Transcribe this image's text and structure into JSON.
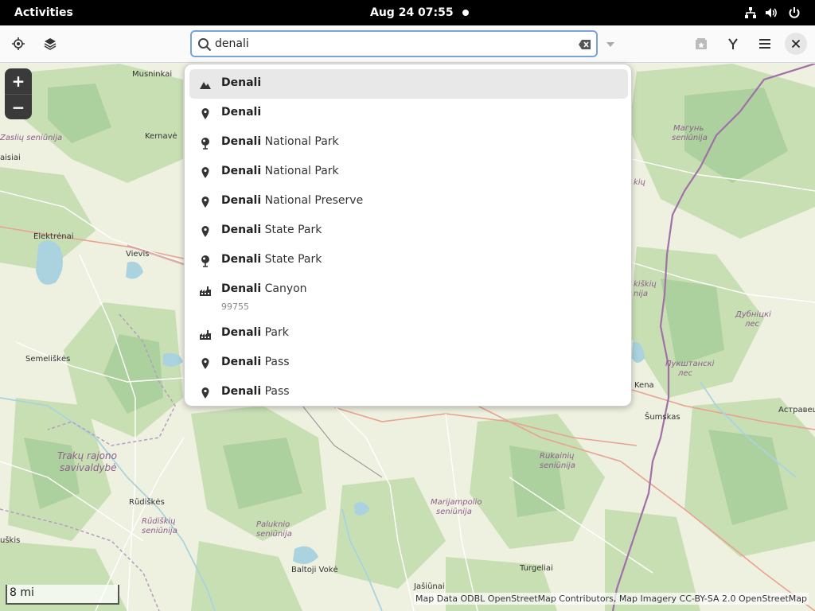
{
  "topbar": {
    "activities": "Activities",
    "clock": "Aug 24  07:55",
    "icons": [
      "network-icon",
      "volume-icon",
      "power-icon"
    ]
  },
  "header": {
    "buttons_left": [
      "locate-icon",
      "layers-icon"
    ],
    "search": {
      "value": "denali",
      "placeholder": ""
    },
    "buttons_right": [
      "favorites-icon",
      "route-icon",
      "menu-icon",
      "close-icon"
    ]
  },
  "results": [
    {
      "icon": "mountain-icon",
      "bold": "Denali",
      "rest": "",
      "sub": ""
    },
    {
      "icon": "pin-icon",
      "bold": "Denali",
      "rest": "",
      "sub": ""
    },
    {
      "icon": "tree-icon",
      "bold": "Denali",
      "rest": " National Park",
      "sub": ""
    },
    {
      "icon": "pin-icon",
      "bold": "Denali",
      "rest": " National Park",
      "sub": ""
    },
    {
      "icon": "pin-icon",
      "bold": "Denali",
      "rest": " National Preserve",
      "sub": ""
    },
    {
      "icon": "pin-icon",
      "bold": "Denali",
      "rest": " State Park",
      "sub": ""
    },
    {
      "icon": "tree-icon",
      "bold": "Denali",
      "rest": " State Park",
      "sub": ""
    },
    {
      "icon": "town-icon",
      "bold": "Denali",
      "rest": " Canyon",
      "sub": "99755"
    },
    {
      "icon": "town-icon",
      "bold": "Denali",
      "rest": " Park",
      "sub": ""
    },
    {
      "icon": "pin-icon",
      "bold": "Denali",
      "rest": " Pass",
      "sub": ""
    },
    {
      "icon": "pin-icon",
      "bold": "Denali",
      "rest": " Pass",
      "sub": ""
    }
  ],
  "map": {
    "zoom_in": "+",
    "zoom_out": "−",
    "scale": "8 mi",
    "attribution": "Map Data ODBL OpenStreetMap Contributors, Map Imagery CC-BY-SA 2.0 OpenStreetMap",
    "places": [
      {
        "name": "Musninkai"
      },
      {
        "name": "Kernavė"
      },
      {
        "name": "Zaslių seniūnija"
      },
      {
        "name": "aisiai"
      },
      {
        "name": "Elektrėnai"
      },
      {
        "name": "Vievis"
      },
      {
        "name": "Semeliškės"
      },
      {
        "name": "Trakų rajono"
      },
      {
        "name": "savivaldybė"
      },
      {
        "name": "Rūdiškės"
      },
      {
        "name": "Rūdiškių"
      },
      {
        "name": "seniūnija"
      },
      {
        "name": "Paluknio"
      },
      {
        "name": "seniūnija"
      },
      {
        "name": "uškis"
      },
      {
        "name": "Baltoji Vokė"
      },
      {
        "name": "Jašiūnai"
      },
      {
        "name": "Turgeliai"
      },
      {
        "name": "Marijampolio"
      },
      {
        "name": "seniūnija"
      },
      {
        "name": "Rukainių"
      },
      {
        "name": "seniūnija"
      },
      {
        "name": "Šumskas"
      },
      {
        "name": "Kena"
      },
      {
        "name": "Магунь"
      },
      {
        "name": "seniūnija"
      },
      {
        "name": "Дубніцкі"
      },
      {
        "name": "лес"
      },
      {
        "name": "Пукштанскі"
      },
      {
        "name": "лес"
      },
      {
        "name": "Астравец"
      },
      {
        "name": "kiškių"
      },
      {
        "name": "nija"
      },
      {
        "name": "kių"
      }
    ]
  },
  "colors": {
    "accent": "#77a3d8",
    "topbar": "#000000",
    "popover": "#ffffff",
    "selected": "#e8e8e8"
  }
}
